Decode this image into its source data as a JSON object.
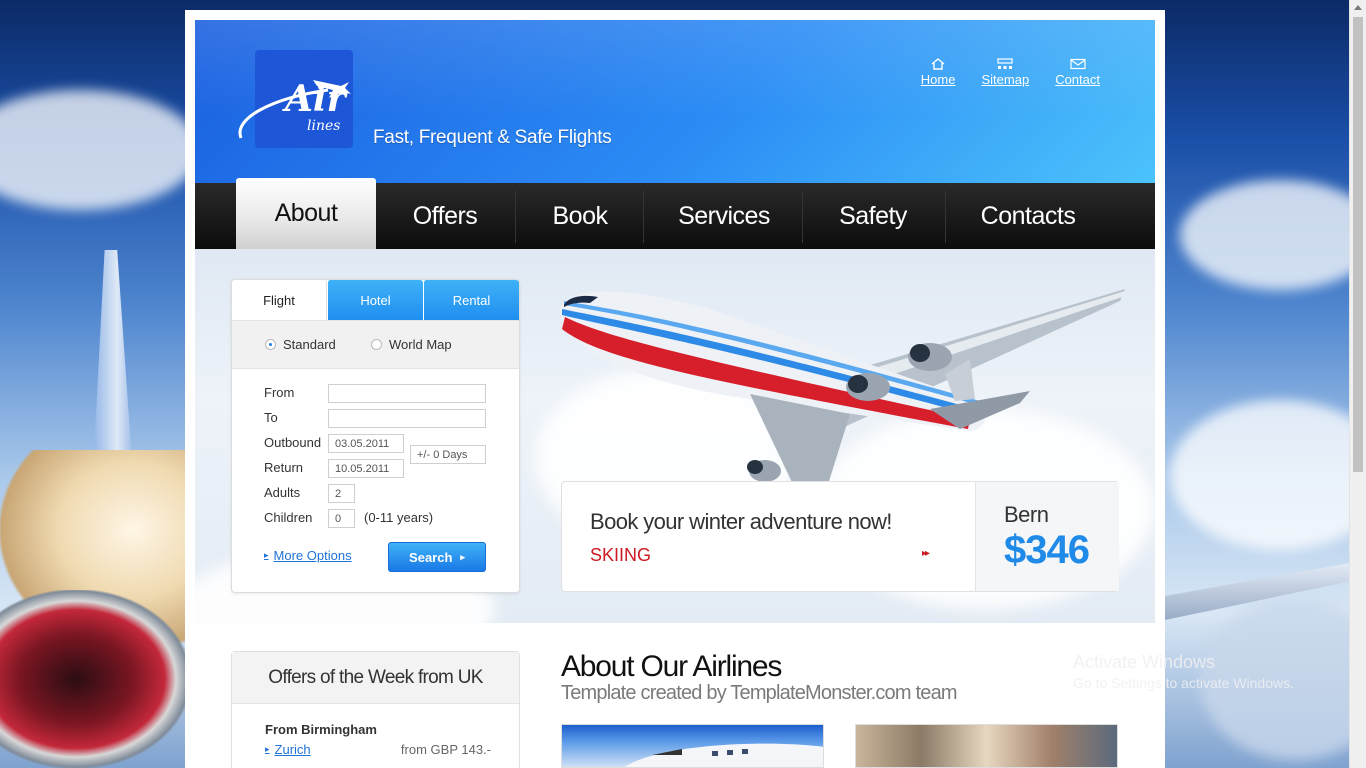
{
  "header": {
    "logo_text": "Air",
    "logo_sub": "lines",
    "tagline": "Fast, Frequent & Safe Flights",
    "links": [
      {
        "label": "Home",
        "icon": "home-icon"
      },
      {
        "label": "Sitemap",
        "icon": "sitemap-icon"
      },
      {
        "label": "Contact",
        "icon": "envelope-icon"
      }
    ]
  },
  "nav": {
    "items": [
      "About",
      "Offers",
      "Book",
      "Services",
      "Safety",
      "Contacts"
    ],
    "active": "About"
  },
  "search": {
    "tabs": [
      "Flight",
      "Hotel",
      "Rental"
    ],
    "active_tab": "Flight",
    "radios": [
      {
        "label": "Standard",
        "checked": true
      },
      {
        "label": "World Map",
        "checked": false
      }
    ],
    "labels": {
      "from": "From",
      "to": "To",
      "outbound": "Outbound",
      "return": "Return",
      "adults": "Adults",
      "children": "Children"
    },
    "values": {
      "from": "",
      "to": "",
      "outbound": "03.05.2011",
      "return": "10.05.2011",
      "days": "+/- 0 Days",
      "adults": "2",
      "children": "0"
    },
    "children_note": "(0-11 years)",
    "more_options": "More Options",
    "submit": "Search"
  },
  "promo": {
    "title": "Book your winter adventure now!",
    "category": "SKIING",
    "city": "Bern",
    "price": "$346"
  },
  "offers": {
    "title": "Offers of the Week from UK",
    "from_label": "From Birmingham",
    "destination": "Zurich",
    "price": "from GBP 143.-"
  },
  "about": {
    "title": "About Our Airlines",
    "subtitle": "Template created by TemplateMonster.com team"
  },
  "watermark": {
    "line1": "Activate Windows",
    "line2": "Go to Settings to activate Windows."
  },
  "colors": {
    "accent": "#1f8ae8",
    "promo_red": "#cc1a22",
    "nav_bg": "#111111"
  }
}
